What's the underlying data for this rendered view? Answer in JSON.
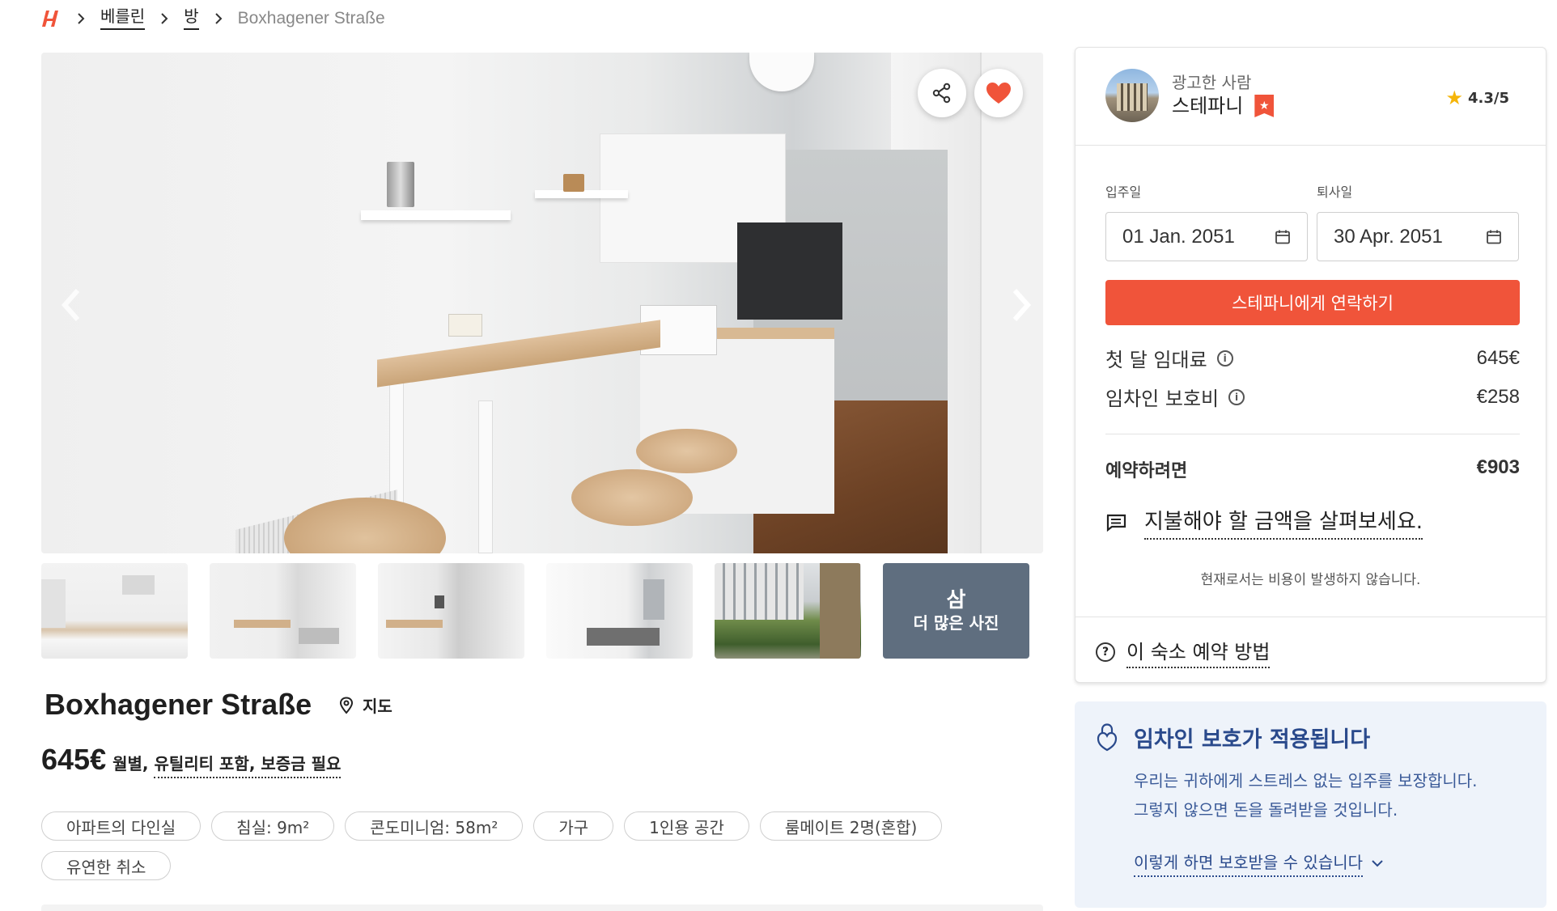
{
  "breadcrumb": {
    "logo_icon": "brand-logo-icon",
    "items": [
      "베를린",
      "방"
    ],
    "current": "Boxhagener Straße"
  },
  "gallery": {
    "share_icon": "share-icon",
    "favorite_icon": "heart-icon",
    "prev_icon": "chevron-left-icon",
    "next_icon": "chevron-right-icon",
    "more_count": "삼",
    "more_label": "더 많은 사진"
  },
  "listing": {
    "title": "Boxhagener Straße",
    "map_label": "지도",
    "price": "645€",
    "price_suffix_1": "월별,",
    "price_suffix_2": "유틸리티 포함,",
    "price_suffix_3": "보증금 필요",
    "tags": [
      "아파트의 다인실",
      "침실: 9m²",
      "콘도미니엄: 58m²",
      "가구",
      "1인용 공간",
      "룸메이트 2명(혼합)",
      "유연한 취소"
    ]
  },
  "host": {
    "role": "광고한 사람",
    "name": "스테파니",
    "rating": "4.3/5"
  },
  "booking": {
    "move_in_label": "입주일",
    "move_in_value": "01 Jan. 2051",
    "move_out_label": "퇴사일",
    "move_out_value": "30 Apr. 2051",
    "contact_button": "스테파니에게 연락하기",
    "first_month_label": "첫 달 임대료",
    "first_month_value": "645€",
    "protection_fee_label": "임차인 보호비",
    "protection_fee_value": "€258",
    "total_label": "예약하려면",
    "total_value": "€903",
    "breakdown_link": "지불해야 할 금액을 살펴보세요.",
    "no_charge_note": "현재로서는 비용이 발생하지 않습니다.",
    "how_to_link": "이 숙소 예약 방법"
  },
  "protection": {
    "title": "임차인 보호가 적용됩니다",
    "body_line_1": "우리는 귀하에게 스트레스 없는 입주를 보장합니다.",
    "body_line_2": "그렇지 않으면 돈을 돌려받을 것입니다.",
    "link": "이렇게 하면 보호받을 수 있습니다"
  },
  "colors": {
    "accent": "#f0543a",
    "protect_bg": "#eef3fa",
    "protect_text": "#2a4a8c"
  }
}
